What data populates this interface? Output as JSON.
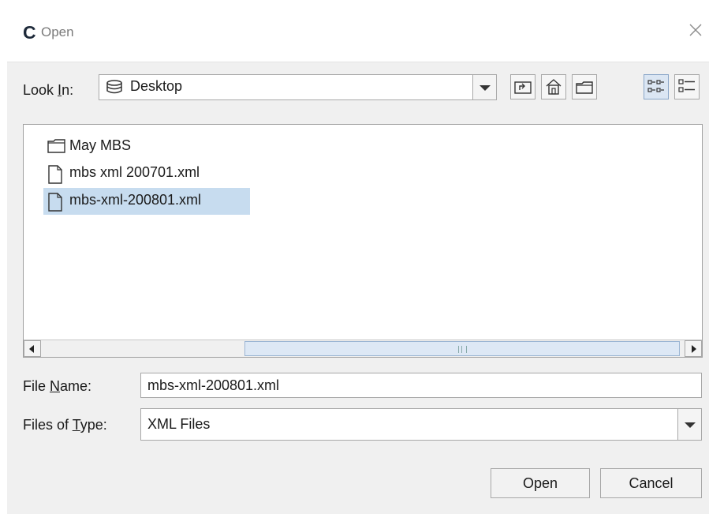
{
  "window": {
    "app_icon": "C",
    "title": "Open"
  },
  "look_in": {
    "label_prefix": "Look ",
    "label_mnemonic": "I",
    "label_suffix": "n:",
    "value": "Desktop",
    "icon": "drive-icon"
  },
  "toolbar": {
    "buttons": [
      {
        "name": "up-one-level",
        "icon": "up-folder-icon"
      },
      {
        "name": "home",
        "icon": "home-icon"
      },
      {
        "name": "new-folder",
        "icon": "new-folder-icon"
      },
      {
        "name": "list-view",
        "icon": "list-view-icon",
        "active": true
      },
      {
        "name": "details-view",
        "icon": "details-view-icon",
        "active": false
      }
    ]
  },
  "files": [
    {
      "name": "May MBS",
      "type": "folder",
      "selected": false
    },
    {
      "name": "mbs xml 200701.xml",
      "type": "file",
      "selected": false
    },
    {
      "name": "mbs-xml-200801.xml",
      "type": "file",
      "selected": true
    }
  ],
  "file_name": {
    "label_prefix": "File ",
    "label_mnemonic": "N",
    "label_suffix": "ame:",
    "value": "mbs-xml-200801.xml"
  },
  "files_of_type": {
    "label_prefix": "Files of ",
    "label_mnemonic": "T",
    "label_suffix": "ype:",
    "value": "XML Files"
  },
  "buttons": {
    "open": "Open",
    "cancel": "Cancel"
  },
  "colors": {
    "selection": "#c7dcef",
    "dialog_bg": "#f0f0f0"
  }
}
